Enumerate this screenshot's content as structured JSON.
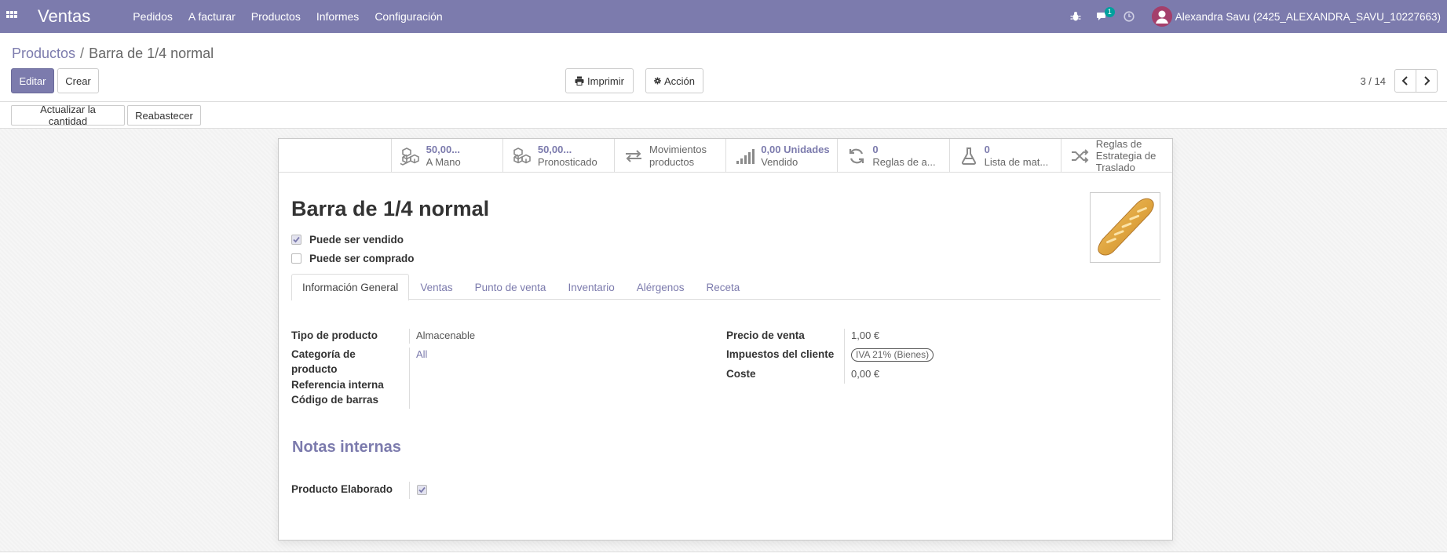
{
  "navbar": {
    "brand": "Ventas",
    "menu": [
      "Pedidos",
      "A facturar",
      "Productos",
      "Informes",
      "Configuración"
    ],
    "chat_badge": "1",
    "user_name": "Alexandra Savu (2425_ALEXANDRA_SAVU_10227663)"
  },
  "breadcrumb": {
    "parent": "Productos",
    "separator": "/",
    "current": "Barra de 1/4 normal"
  },
  "buttons": {
    "edit": "Editar",
    "create": "Crear",
    "print": "Imprimir",
    "action": "Acción",
    "update_qty": "Actualizar la cantidad",
    "replenish": "Reabastecer"
  },
  "pager": {
    "value": "3 / 14"
  },
  "smart_buttons": [
    {
      "value": "50,00...",
      "label": "A Mano",
      "icon": "cubes-icon"
    },
    {
      "value": "50,00...",
      "label": "Pronosticado",
      "icon": "cubes-icon"
    },
    {
      "line1": "Movimientos",
      "line2": "productos",
      "icon": "exchange-icon"
    },
    {
      "value": "0,00 Unidades",
      "label": "Vendido",
      "icon": "signal-icon"
    },
    {
      "value": "0",
      "label": "Reglas de a...",
      "icon": "refresh-icon"
    },
    {
      "value": "0",
      "label": "Lista de mat...",
      "icon": "flask-icon"
    },
    {
      "line1": "Reglas de",
      "line2": "Estrategia de",
      "line3": "Traslado",
      "icon": "random-icon"
    }
  ],
  "product": {
    "name": "Barra de 1/4 normal",
    "can_be_sold_label": "Puede ser vendido",
    "can_be_sold": true,
    "can_be_purchased_label": "Puede ser comprado",
    "can_be_purchased": false
  },
  "tabs": [
    "Información General",
    "Ventas",
    "Punto de venta",
    "Inventario",
    "Alérgenos",
    "Receta"
  ],
  "general_info": {
    "left": {
      "product_type_label": "Tipo de producto",
      "product_type": "Almacenable",
      "category_label_1": "Categoría de",
      "category_label_2": "producto",
      "category": "All",
      "internal_ref_label": "Referencia interna",
      "barcode_label": "Código de barras"
    },
    "right": {
      "sale_price_label": "Precio de venta",
      "sale_price": "1,00 €",
      "customer_taxes_label": "Impuestos del cliente",
      "customer_tax": "IVA 21% (Bienes)",
      "cost_label": "Coste",
      "cost": "0,00 €"
    }
  },
  "notes": {
    "title": "Notas internas",
    "manufactured_label": "Producto Elaborado",
    "manufactured": true
  },
  "colors": {
    "primary": "#7c7bad",
    "avatar": "#a43f6b",
    "badge": "#00a09d"
  }
}
